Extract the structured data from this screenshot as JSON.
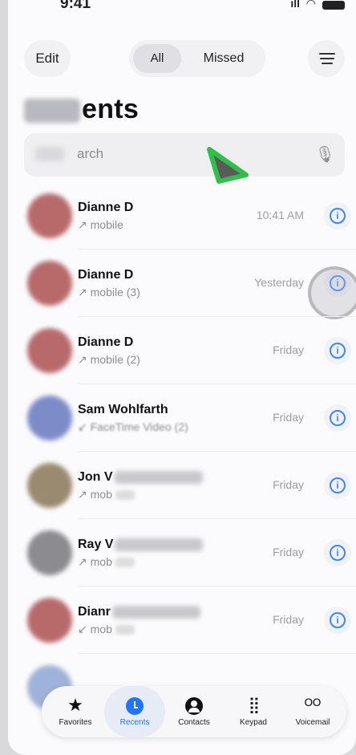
{
  "status": {
    "time": "9:41",
    "signal_icon": "signal-icon",
    "wifi_icon": "wifi-icon",
    "battery_icon": "battery-icon"
  },
  "topbar": {
    "edit_label": "Edit",
    "segment_all": "All",
    "segment_missed": "Missed",
    "menu_icon": "filter-menu-icon"
  },
  "title": "ents",
  "search": {
    "placeholder": "arch",
    "mic_icon": "microphone-icon"
  },
  "calls": [
    {
      "name": "Dianne D",
      "detail": "↗ mobile",
      "when": "10:41 AM"
    },
    {
      "name": "Dianne D",
      "detail": "↗ mobile (3)",
      "when": "Yesterday"
    },
    {
      "name": "Dianne D",
      "detail": "↗ mobile (2)",
      "when": "Friday"
    },
    {
      "name": "Sam Wohlfarth",
      "detail": "↙ FaceTime Video (2)",
      "when": "Friday"
    },
    {
      "name": "Jon V",
      "detail": "↗ mob",
      "when": "Friday"
    },
    {
      "name": "Ray V",
      "detail": "↗ mob",
      "when": "Friday"
    },
    {
      "name": "Dianr",
      "detail": "↙ mob",
      "when": "Friday"
    }
  ],
  "tabs": [
    {
      "label": "Favorites",
      "icon": "star-icon"
    },
    {
      "label": "Recents",
      "icon": "clock-icon"
    },
    {
      "label": "Contacts",
      "icon": "person-icon"
    },
    {
      "label": "Keypad",
      "icon": "keypad-icon"
    },
    {
      "label": "Voicemail",
      "icon": "voicemail-icon"
    }
  ],
  "colors": {
    "accent": "#1f75ff",
    "info": "#3e85ff",
    "cursor": "#2fbf4a"
  }
}
